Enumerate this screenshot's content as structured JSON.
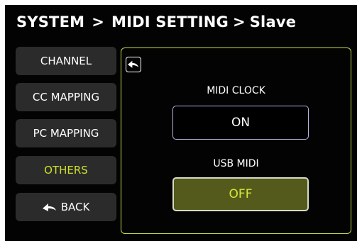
{
  "header": {
    "path": [
      "SYSTEM",
      "MIDI SETTING",
      "Slave"
    ],
    "separator": ">"
  },
  "sidebar": {
    "items": [
      {
        "label": "CHANNEL",
        "active": false
      },
      {
        "label": "CC MAPPING",
        "active": false
      },
      {
        "label": "PC MAPPING",
        "active": false
      },
      {
        "label": "OTHERS",
        "active": true
      },
      {
        "label": "BACK",
        "icon": "back-arrow-icon",
        "active": false
      }
    ]
  },
  "panel": {
    "return_icon": "return-arrow-icon",
    "midi_clock": {
      "label": "MIDI CLOCK",
      "value": "ON"
    },
    "usb_midi": {
      "label": "USB MIDI",
      "value": "OFF"
    }
  },
  "colors": {
    "background": "#030303",
    "accent": "#cde02a",
    "panel_border": "#c6d94a",
    "button_bg": "#2b2b2b",
    "off_fill": "#545a1b"
  }
}
